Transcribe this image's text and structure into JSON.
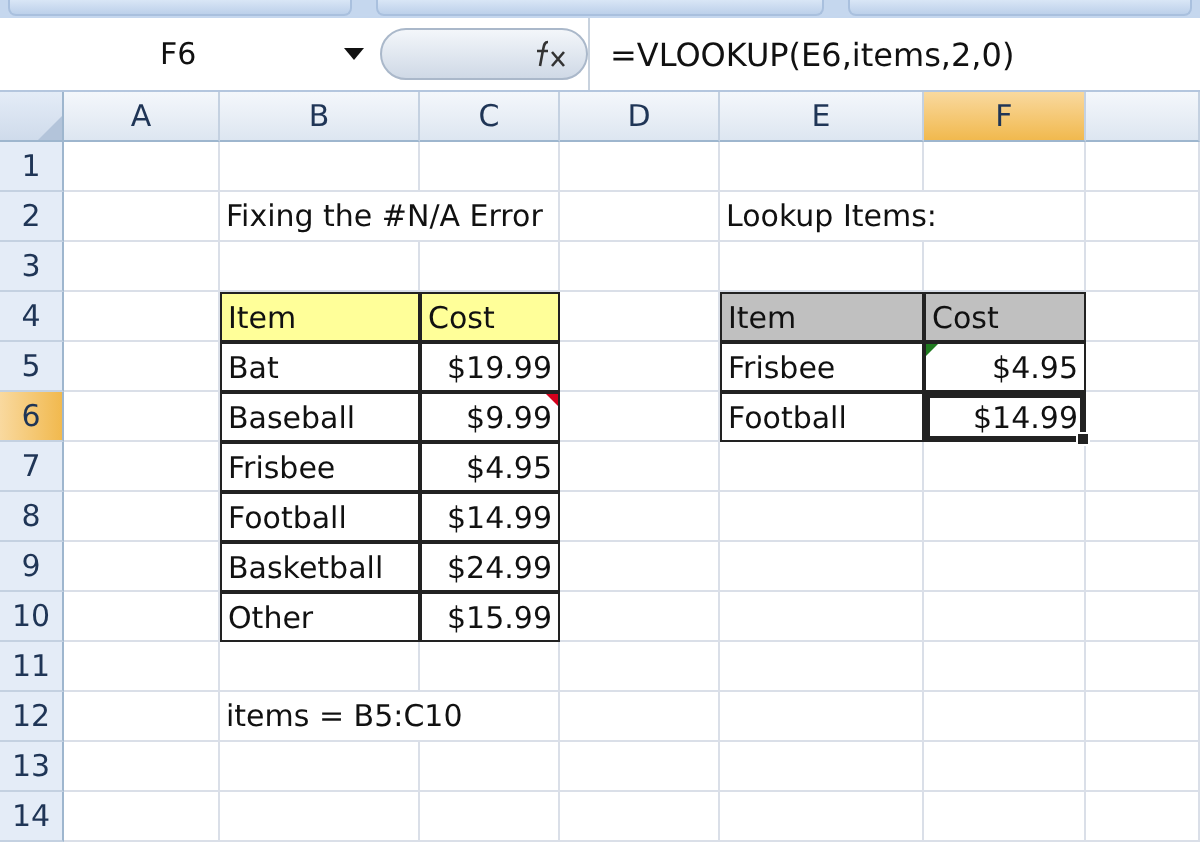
{
  "formula_bar": {
    "name_box": "F6",
    "formula": "=VLOOKUP(E6,items,2,0)"
  },
  "columns": [
    {
      "label": "A",
      "selected": false
    },
    {
      "label": "B",
      "selected": false
    },
    {
      "label": "C",
      "selected": false
    },
    {
      "label": "D",
      "selected": false
    },
    {
      "label": "E",
      "selected": false
    },
    {
      "label": "F",
      "selected": true
    }
  ],
  "rows": [
    {
      "label": "1",
      "selected": false
    },
    {
      "label": "2",
      "selected": false,
      "col_b": {
        "kind": "text",
        "text": "Fixing the #N/A Error"
      },
      "col_e": {
        "kind": "text",
        "text": "Lookup Items:"
      }
    },
    {
      "label": "3",
      "selected": false
    },
    {
      "label": "4",
      "selected": false,
      "col_b": {
        "kind": "head-yellow",
        "text": "Item"
      },
      "col_c": {
        "kind": "head-yellow",
        "text": "Cost"
      },
      "col_e": {
        "kind": "head-grey",
        "text": "Item"
      },
      "col_f": {
        "kind": "head-grey",
        "text": "Cost"
      }
    },
    {
      "label": "5",
      "selected": false,
      "col_b": {
        "kind": "boxed",
        "text": "Bat"
      },
      "col_c": {
        "kind": "boxed-number",
        "text": "$19.99"
      },
      "col_e": {
        "kind": "boxed",
        "text": "Frisbee"
      },
      "col_f": {
        "kind": "boxed-number",
        "text": "$4.95",
        "error_flag": true
      }
    },
    {
      "label": "6",
      "selected": true,
      "col_b": {
        "kind": "boxed",
        "text": "Baseball"
      },
      "col_c": {
        "kind": "boxed-number",
        "text": "$9.99",
        "comment": true
      },
      "col_e": {
        "kind": "boxed",
        "text": "Football"
      },
      "col_f": {
        "kind": "boxed-number",
        "text": "$14.99",
        "selected": true
      }
    },
    {
      "label": "7",
      "selected": false,
      "col_b": {
        "kind": "boxed",
        "text": "Frisbee"
      },
      "col_c": {
        "kind": "boxed-number",
        "text": "$4.95"
      }
    },
    {
      "label": "8",
      "selected": false,
      "col_b": {
        "kind": "boxed",
        "text": "Football"
      },
      "col_c": {
        "kind": "boxed-number",
        "text": "$14.99"
      }
    },
    {
      "label": "9",
      "selected": false,
      "col_b": {
        "kind": "boxed",
        "text": "Basketball"
      },
      "col_c": {
        "kind": "boxed-number",
        "text": "$24.99"
      }
    },
    {
      "label": "10",
      "selected": false,
      "col_b": {
        "kind": "boxed",
        "text": "Other"
      },
      "col_c": {
        "kind": "boxed-number",
        "text": "$15.99"
      }
    },
    {
      "label": "11",
      "selected": false
    },
    {
      "label": "12",
      "selected": false,
      "col_b": {
        "kind": "text",
        "text": "items = B5:C10"
      }
    },
    {
      "label": "13",
      "selected": false
    },
    {
      "label": "14",
      "selected": false
    }
  ]
}
